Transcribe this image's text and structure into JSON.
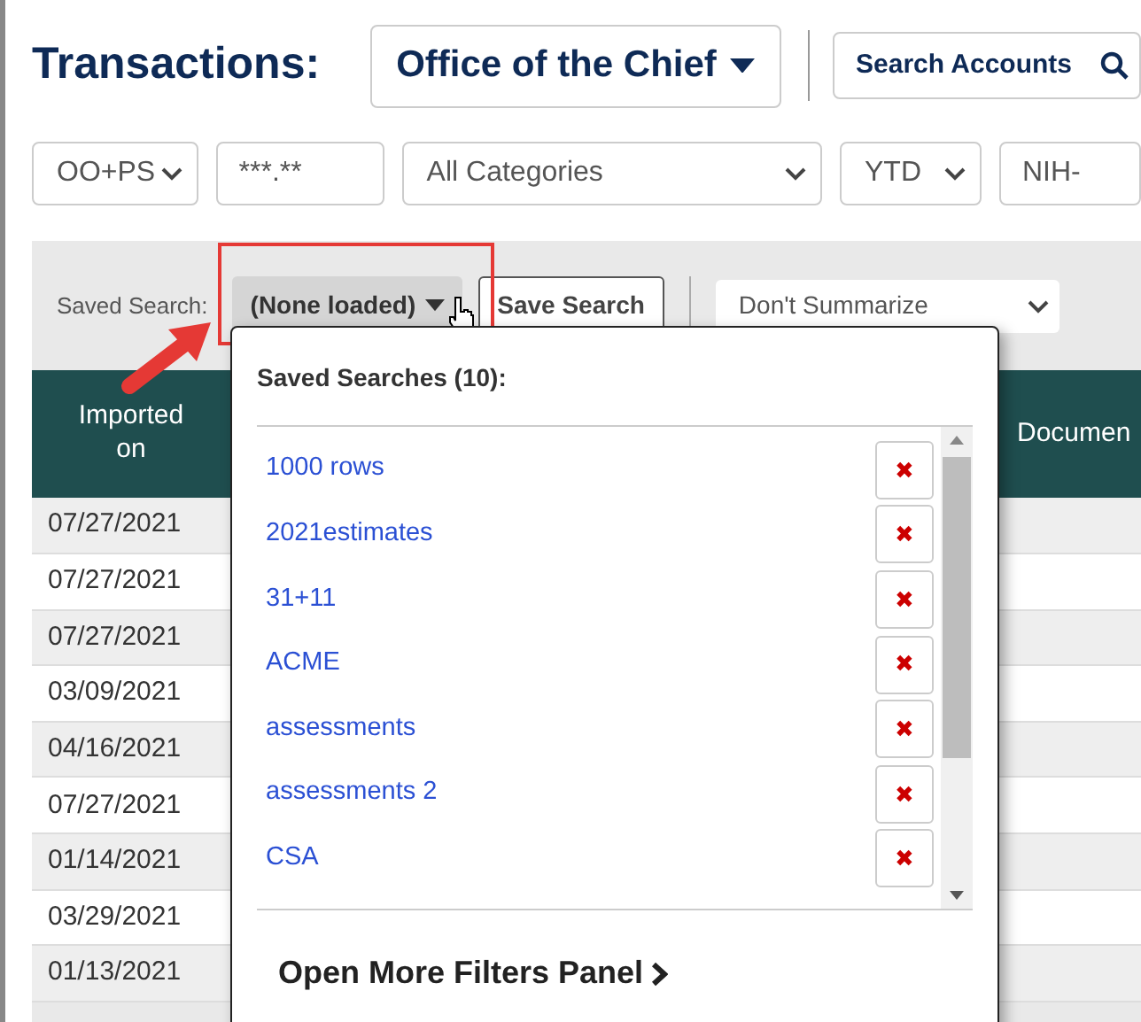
{
  "title": "Transactions:",
  "office_selector": {
    "label": "Office of the Chief"
  },
  "search_accounts": {
    "label": "Search Accounts"
  },
  "filters": [
    {
      "kind": "select",
      "value": "OO+PS"
    },
    {
      "kind": "input",
      "value": "***.**"
    },
    {
      "kind": "select",
      "value": "All Categories"
    },
    {
      "kind": "select",
      "value": "YTD"
    },
    {
      "kind": "input",
      "value": "NIH-"
    }
  ],
  "saved_search": {
    "label": "Saved Search:",
    "button": "(None loaded)",
    "save_button": "Save Search",
    "summarize": "Don't Summarize"
  },
  "table": {
    "columns": [
      "Imported on",
      "Documen"
    ],
    "rows": [
      "07/27/2021",
      "07/27/2021",
      "07/27/2021",
      "03/09/2021",
      "04/16/2021",
      "07/27/2021",
      "01/14/2021",
      "03/29/2021",
      "01/13/2021"
    ]
  },
  "saved_menu": {
    "header": "Saved Searches (10):",
    "items": [
      "1000 rows",
      "2021estimates",
      "31+11",
      "ACME",
      "assessments",
      "assessments 2",
      "CSA"
    ],
    "delete_symbol": "✖",
    "footer": "Open More Filters Panel"
  }
}
